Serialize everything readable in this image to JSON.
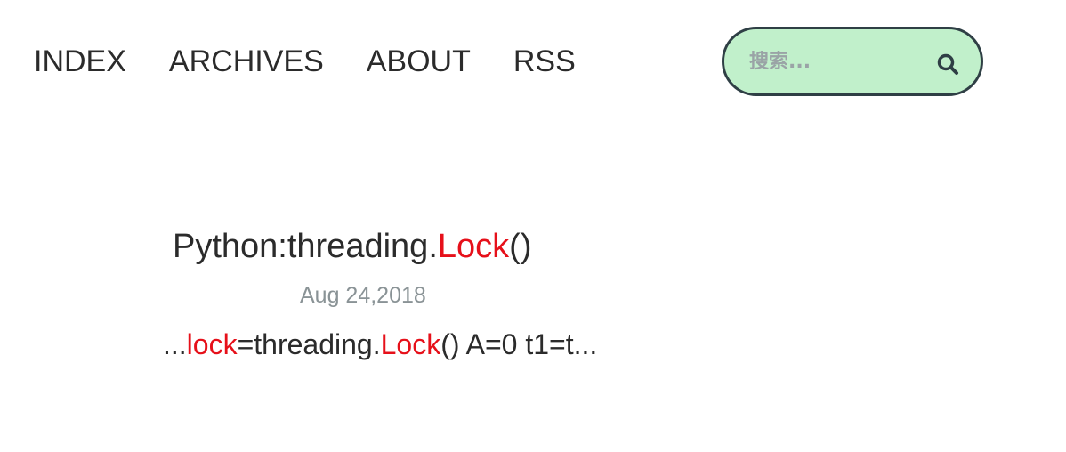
{
  "nav": {
    "items": [
      "INDEX",
      "ARCHIVES",
      "ABOUT",
      "RSS"
    ]
  },
  "search": {
    "placeholder": "搜索..."
  },
  "post": {
    "title_parts": [
      "Python:threading.",
      "Lock",
      "()"
    ],
    "date": "Aug 24,2018",
    "excerpt_parts": [
      "...",
      "lock",
      "=threading.",
      "Lock",
      "() A=0 t1=t..."
    ]
  },
  "colors": {
    "highlight": "#e6101a",
    "search_bg": "#c1f0cb",
    "search_border": "#2f3f45",
    "text": "#2b2b2b",
    "muted": "#8a9396"
  },
  "icons": {
    "search_button": "search-icon"
  }
}
